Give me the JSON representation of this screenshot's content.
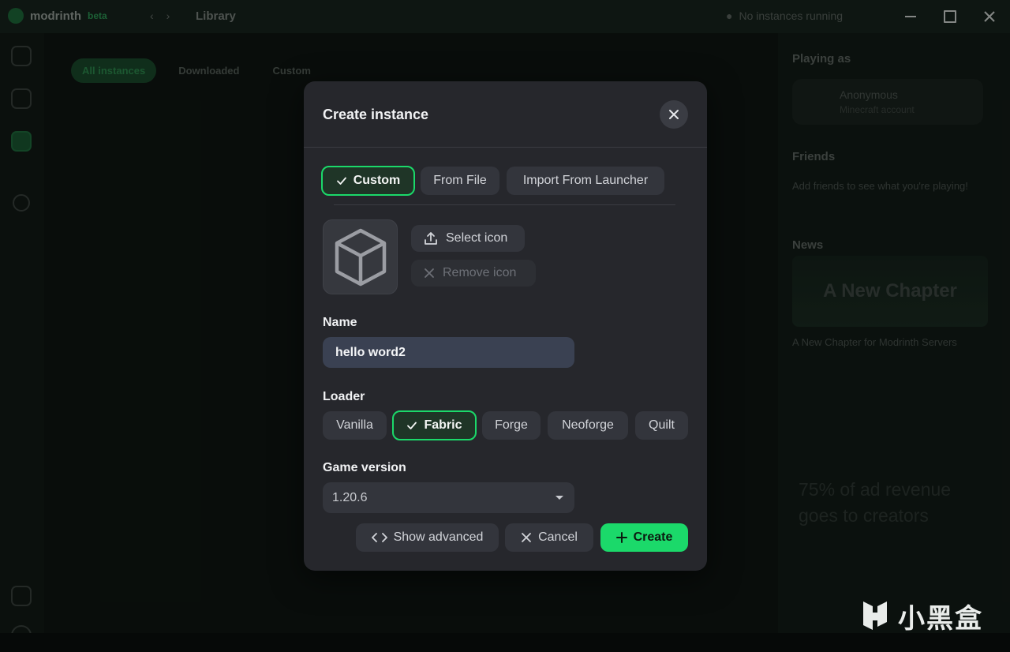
{
  "background": {
    "brand": "modrinth",
    "brand_tag": "beta",
    "breadcrumb": "Library",
    "instances_status": "No instances running",
    "main_tabs": [
      "All instances",
      "Downloaded",
      "Custom"
    ],
    "right_panel": {
      "playing_as": "Playing as",
      "account_name": "Anonymous",
      "account_sub": "Minecraft account",
      "friends": "Friends",
      "friends_text": "Add friends to see what you're playing!",
      "news": "News",
      "news_banner": "A New Chapter",
      "news_caption": "A New Chapter for Modrinth Servers",
      "promo": "75% of ad revenue goes to creators"
    },
    "watermark": "小黑盒"
  },
  "modal": {
    "title": "Create instance",
    "source_tabs": [
      {
        "label": "Custom",
        "selected": true
      },
      {
        "label": "From File",
        "selected": false
      },
      {
        "label": "Import From Launcher",
        "selected": false
      }
    ],
    "select_icon": "Select icon",
    "remove_icon": "Remove icon",
    "name_label": "Name",
    "name_value": "hello word2",
    "loader_label": "Loader",
    "loaders": [
      {
        "label": "Vanilla",
        "selected": false
      },
      {
        "label": "Fabric",
        "selected": true
      },
      {
        "label": "Forge",
        "selected": false
      },
      {
        "label": "Neoforge",
        "selected": false
      },
      {
        "label": "Quilt",
        "selected": false
      }
    ],
    "game_version_label": "Game version",
    "game_version_value": "1.20.6",
    "show_advanced": "Show advanced",
    "cancel": "Cancel",
    "create": "Create"
  },
  "colors": {
    "accent": "#1bd96a",
    "modal_bg": "#26272c",
    "button_bg": "#33353c",
    "input_bg": "#3a4152"
  }
}
